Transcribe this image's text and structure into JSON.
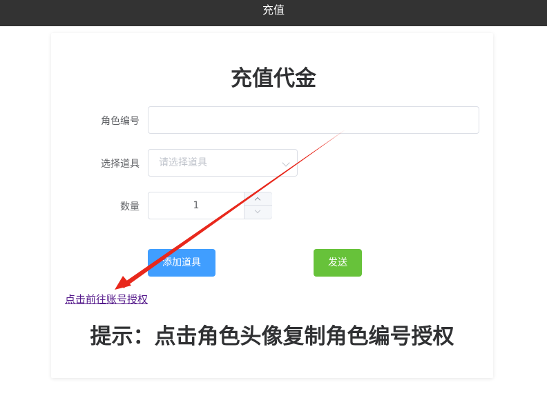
{
  "topbar": {
    "title": "充值"
  },
  "form": {
    "title": "充值代金",
    "role_id": {
      "label": "角色编号",
      "value": ""
    },
    "item_select": {
      "label": "选择道具",
      "placeholder": "请选择道具"
    },
    "quantity": {
      "label": "数量",
      "value": "1"
    },
    "add_item_label": "添加道具",
    "send_label": "发送"
  },
  "auth_link": "点击前往账号授权",
  "hint": "提示：点击角色头像复制角色编号授权",
  "colors": {
    "primary": "#409eff",
    "success": "#67c23a",
    "annotation_arrow": "#e8281c",
    "topbar": "#333333"
  }
}
